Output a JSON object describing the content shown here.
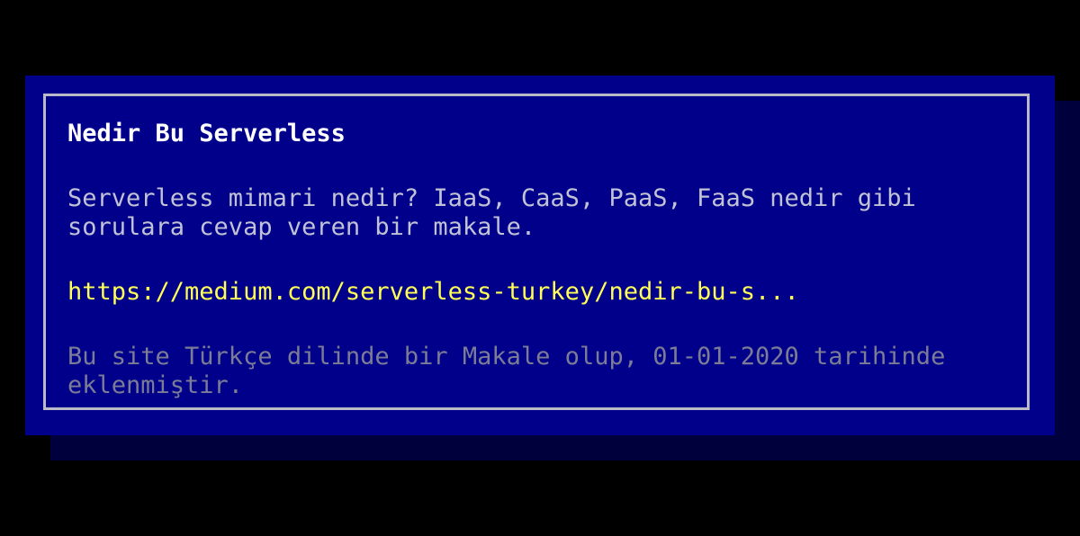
{
  "card": {
    "title": "Nedir Bu Serverless",
    "description": "Serverless mimari nedir? IaaS, CaaS, PaaS, FaaS nedir gibi sorulara cevap veren bir makale.",
    "url": "https://medium.com/serverless-turkey/nedir-bu-s...",
    "meta": "Bu site Türkçe dilinde bir Makale olup, 01-01-2020 tarihinde eklenmiştir."
  },
  "colors": {
    "background": "#000000",
    "panel": "#00008b",
    "shadow": "#00003c",
    "border": "#b9b9c8",
    "title": "#ffffff",
    "description": "#c2c2d6",
    "link": "#ffff55",
    "meta": "#7c7c96"
  }
}
